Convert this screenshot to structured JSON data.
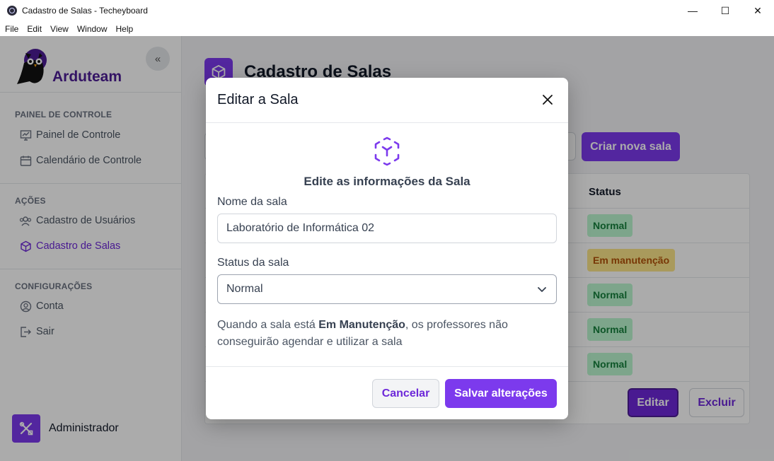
{
  "window": {
    "title": "Cadastro de Salas - Techeyboard",
    "minimize_glyph": "—",
    "maximize_glyph": "☐",
    "close_glyph": "✕"
  },
  "menu": [
    "File",
    "Edit",
    "View",
    "Window",
    "Help"
  ],
  "sidebar": {
    "brand": "Arduteam",
    "collapse_glyph": "«",
    "sections": [
      {
        "title": "PAINEL DE CONTROLE",
        "items": [
          {
            "label": "Painel de Controle",
            "icon": "chart-icon"
          },
          {
            "label": "Calendário de Controle",
            "icon": "calendar-icon"
          }
        ]
      },
      {
        "title": "AÇÕES",
        "items": [
          {
            "label": "Cadastro de Usuários",
            "icon": "users-icon"
          },
          {
            "label": "Cadastro de Salas",
            "icon": "cube-icon",
            "active": true
          }
        ]
      },
      {
        "title": "CONFIGURAÇÕES",
        "items": [
          {
            "label": "Conta",
            "icon": "user-circle-icon"
          },
          {
            "label": "Sair",
            "icon": "logout-icon"
          }
        ]
      }
    ],
    "user": "Administrador"
  },
  "main": {
    "title": "Cadastro de Salas",
    "create_button": "Criar nova sala",
    "table": {
      "status_header": "Status",
      "rows": [
        {
          "status": "Normal",
          "kind": "ok"
        },
        {
          "status": "Em manutenção",
          "kind": "warn"
        },
        {
          "status": "Normal",
          "kind": "ok"
        },
        {
          "status": "Normal",
          "kind": "ok"
        },
        {
          "status": "Normal",
          "kind": "ok"
        }
      ]
    },
    "edit_button": "Editar",
    "delete_button": "Excluir"
  },
  "modal": {
    "title": "Editar a Sala",
    "subtitle": "Edite as informações da Sala",
    "name_label": "Nome da sala",
    "name_value": "Laboratório de Informática 02",
    "status_label": "Status da sala",
    "status_value": "Normal",
    "help_prefix": "Quando a sala está ",
    "help_bold": "Em Manutenção",
    "help_suffix": ", os professores não conseguirão agendar e utilizar a sala",
    "cancel_button": "Cancelar",
    "save_button": "Salvar alterações"
  },
  "colors": {
    "brand_purple": "#7c3aed",
    "brand_dark": "#4c1d95",
    "status_ok_bg": "#bbf7d0",
    "status_warn_bg": "#fde68a"
  }
}
